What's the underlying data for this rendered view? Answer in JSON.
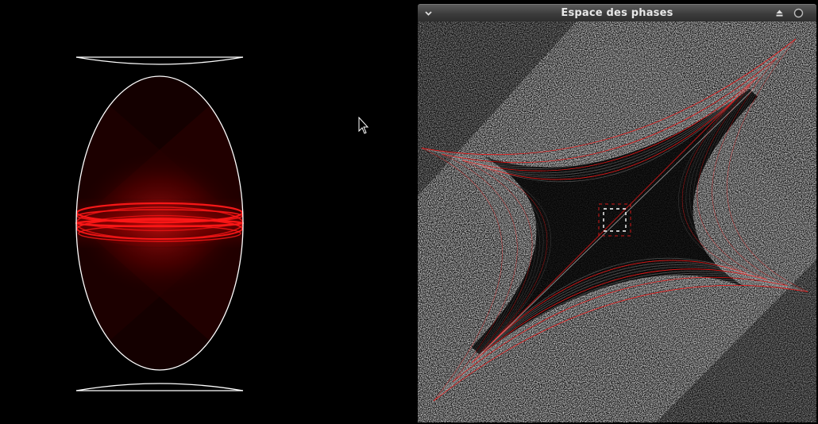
{
  "window": {
    "title": "Espace des phases",
    "menu_icon": "chevron-down-icon",
    "shade_icon": "eject-icon",
    "close_icon": "circle-close-icon"
  },
  "colors": {
    "background": "#000000",
    "boundary": "#ffffff",
    "trajectory": "#ff1a1a",
    "phase_points": "#b4b4b4",
    "titlebar": "#3c3c3c",
    "title_text": "#e8e8e8"
  },
  "cursor_icon": "arrow-pointer-icon"
}
